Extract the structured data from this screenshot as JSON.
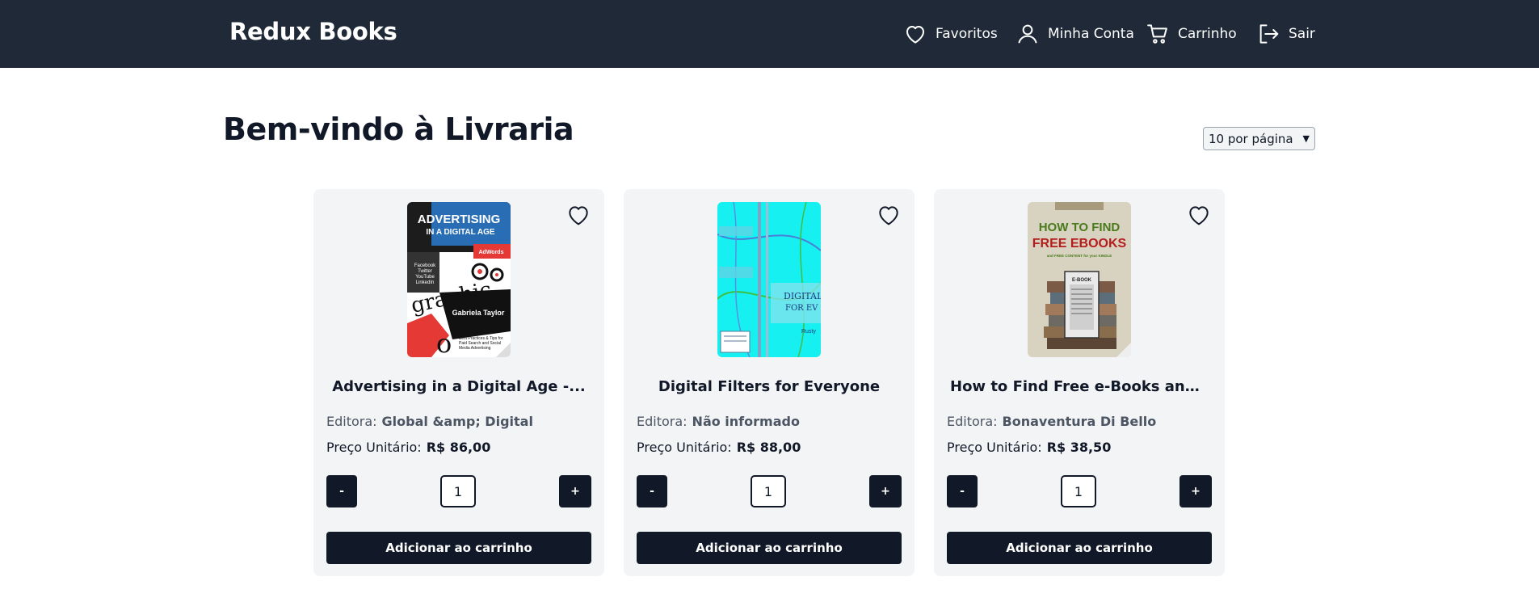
{
  "header": {
    "brand": "Redux Books",
    "nav": {
      "favorites": "Favoritos",
      "account": "Minha Conta",
      "cart": "Carrinho",
      "logout": "Sair"
    }
  },
  "main": {
    "title": "Bem-vindo à Livraria",
    "per_page": "10 por página"
  },
  "labels": {
    "publisher": "Editora:",
    "unit_price": "Preço Unitário:",
    "minus": "-",
    "plus": "+",
    "add_to_cart": "Adicionar ao carrinho"
  },
  "books": [
    {
      "title": "Advertising in a Digital Age -...",
      "publisher": "Global &amp; Digital",
      "price": "R$ 86,00",
      "quantity": "1",
      "cover_text": {
        "line1": "ADVERTISING",
        "line2": "IN A DIGITAL AGE",
        "tag": "AdWords",
        "list1": "Facebook",
        "list2": "Twitter",
        "list3": "YouTube",
        "list4": "LinkedIn",
        "graphic": "graphic",
        "author": "Gabriela Taylor",
        "footer1": "Best Practices & Tips for",
        "footer2": "Paid Search and Social",
        "footer3": "Media Advertising"
      }
    },
    {
      "title": "Digital Filters for Everyone",
      "publisher": "Não informado",
      "price": "R$ 88,00",
      "quantity": "1",
      "cover_text": {
        "line1": "DIGITAL",
        "line2": "FOR EV",
        "author": "Rusty"
      }
    },
    {
      "title": "How to Find Free e-Books and F...",
      "publisher": "Bonaventura Di Bello",
      "price": "R$ 38,50",
      "quantity": "1",
      "cover_text": {
        "line1": "HOW TO FIND",
        "line2": "FREE EBOOKS",
        "line3": "and FREE CONTENT for your KINDLE",
        "device": "E-BOOK"
      }
    }
  ],
  "colors": {
    "navbar": "#1f2937",
    "button": "#111827",
    "card": "#f3f4f6"
  }
}
